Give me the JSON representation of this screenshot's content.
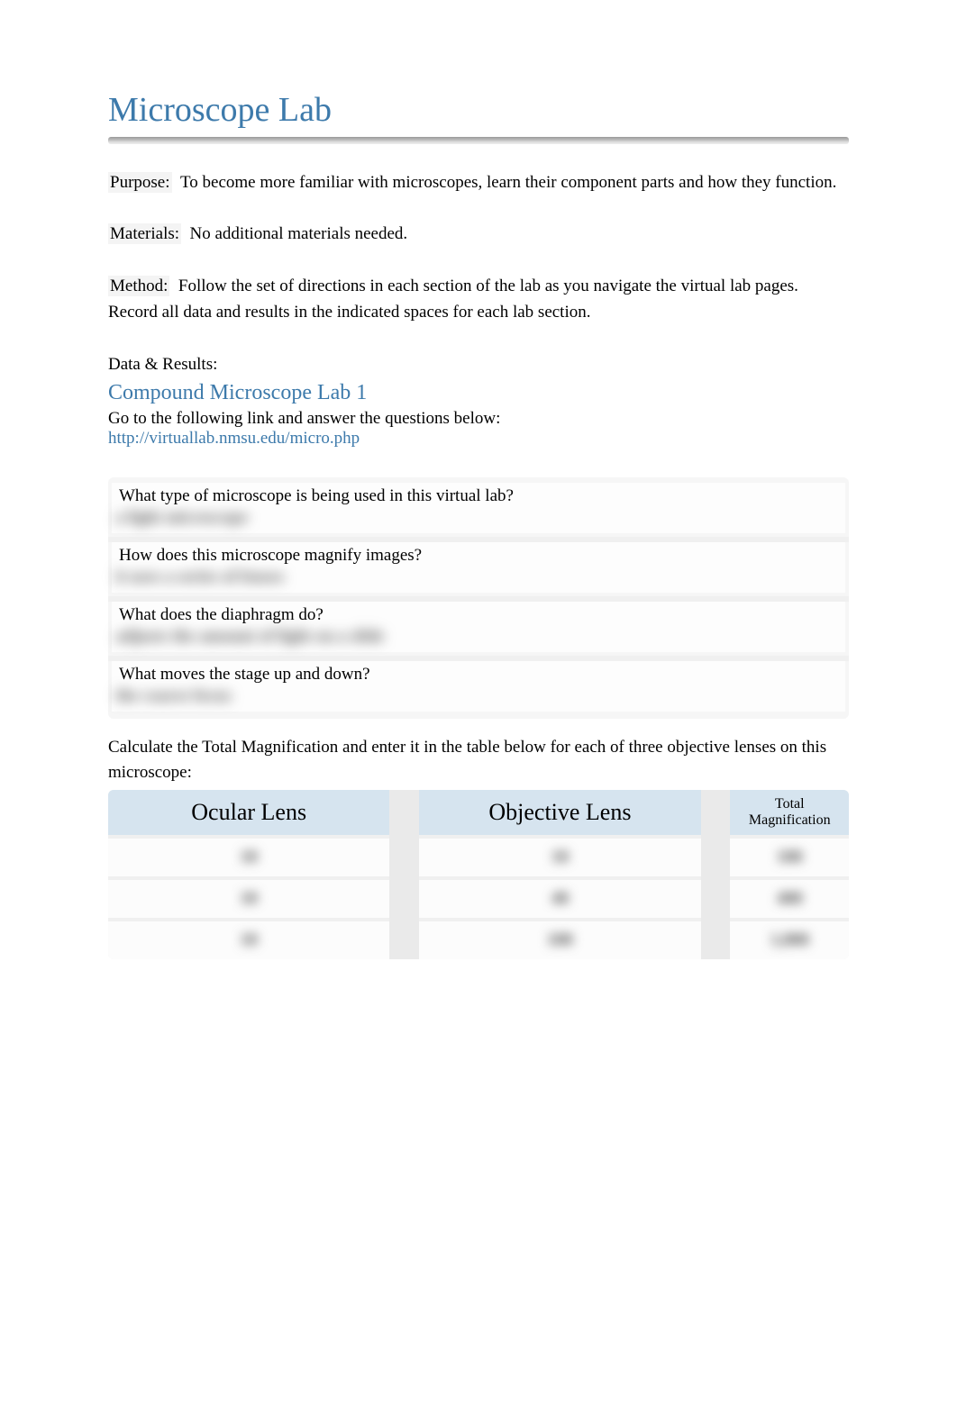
{
  "title": "Microscope Lab",
  "purpose": {
    "label": "Purpose:",
    "text": "To become more familiar with microscopes, learn their component parts and how they function."
  },
  "materials": {
    "label": "Materials:",
    "text": "No additional materials needed."
  },
  "method": {
    "label": "Method:",
    "text": "Follow the set of directions in each section of the lab as you navigate the virtual lab pages. Record all data and results in the indicated spaces for each lab section."
  },
  "data_results_label": "Data & Results:",
  "section1": {
    "heading": "Compound Microscope Lab 1",
    "intro": "Go to the following link and answer the questions below:",
    "link": "http://virtuallab.nmsu.edu/micro.php"
  },
  "qa": [
    {
      "q": "What type of microscope is being used in this virtual lab?",
      "a": "a light microscope"
    },
    {
      "q": "How does this microscope magnify images?",
      "a": "it uses a series of lenses"
    },
    {
      "q": "What does the diaphragm do?",
      "a": "adjusts the amount of light on a slide"
    },
    {
      "q": "What moves the stage up and down?",
      "a": "the coarse focus"
    }
  ],
  "calc_text": "Calculate the Total Magnification and enter it in the table below for each of three objective lenses on this microscope:",
  "table": {
    "headers": {
      "ocular": "Ocular Lens",
      "objective": "Objective Lens",
      "total": "Total Magnification"
    },
    "rows": [
      {
        "ocular": "10",
        "objective": "10",
        "total": "100"
      },
      {
        "ocular": "10",
        "objective": "40",
        "total": "400"
      },
      {
        "ocular": "10",
        "objective": "100",
        "total": "1,000"
      }
    ]
  }
}
